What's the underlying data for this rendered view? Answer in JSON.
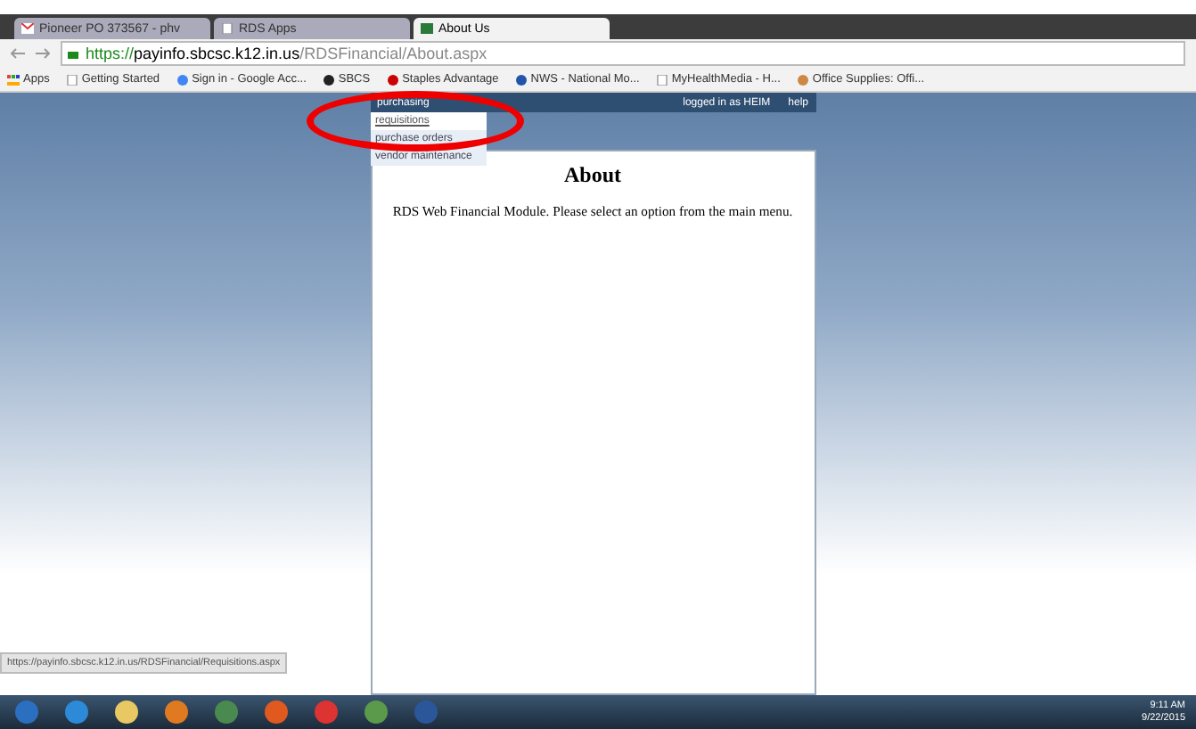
{
  "tabs": [
    {
      "title": "Pioneer PO 373567 - phv",
      "kind": "mail",
      "selected": false
    },
    {
      "title": "RDS Apps",
      "kind": "page",
      "selected": false
    },
    {
      "title": "About Us",
      "kind": "site",
      "selected": true
    }
  ],
  "address": {
    "secure": "https://",
    "host": "payinfo.sbcsc.k12.in.us",
    "path": "/RDSFinancial/About.aspx"
  },
  "bookmarks": [
    {
      "label": "Apps",
      "kind": "apps"
    },
    {
      "label": "Getting Started",
      "kind": "page"
    },
    {
      "label": "Sign in - Google Acc...",
      "kind": "google"
    },
    {
      "label": "SBCS",
      "kind": "globe"
    },
    {
      "label": "Staples Advantage",
      "kind": "staples"
    },
    {
      "label": "NWS - National Mo...",
      "kind": "nws"
    },
    {
      "label": "MyHealthMedia - H...",
      "kind": "page"
    },
    {
      "label": "Office Supplies: Offi...",
      "kind": "pen"
    }
  ],
  "site": {
    "menu": "purchasing",
    "user": "logged in as HEIM",
    "help": "help",
    "dropdown": [
      {
        "label": "requisitions",
        "selected": true
      },
      {
        "label": "purchase orders",
        "selected": false
      },
      {
        "label": "vendor maintenance",
        "selected": false
      }
    ],
    "heading": "About",
    "message": "RDS Web Financial Module. Please select an option from the main menu."
  },
  "status_url": "https://payinfo.sbcsc.k12.in.us/RDSFinancial/Requisitions.aspx",
  "taskbar": {
    "apps": [
      {
        "kind": "start"
      },
      {
        "kind": "ie"
      },
      {
        "kind": "explorer"
      },
      {
        "kind": "media"
      },
      {
        "kind": "photos"
      },
      {
        "kind": "firefox"
      },
      {
        "kind": "chrome"
      },
      {
        "kind": "network"
      },
      {
        "kind": "word"
      }
    ],
    "time": "9:11 AM",
    "date": "9/22/2015"
  }
}
